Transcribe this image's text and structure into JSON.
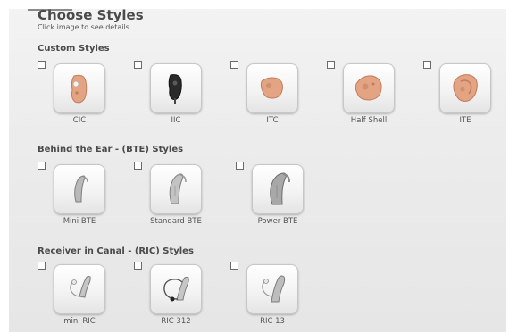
{
  "header": {
    "title": "Choose Styles",
    "subtitle": "Click image to see details"
  },
  "sections": [
    {
      "heading": "Custom Styles",
      "items": [
        {
          "label": "CIC",
          "icon": "cic-hearing-aid-icon"
        },
        {
          "label": "IIC",
          "icon": "iic-hearing-aid-icon"
        },
        {
          "label": "ITC",
          "icon": "itc-hearing-aid-icon"
        },
        {
          "label": "Half Shell",
          "icon": "half-shell-hearing-aid-icon"
        },
        {
          "label": "ITE",
          "icon": "ite-hearing-aid-icon"
        }
      ]
    },
    {
      "heading": "Behind the Ear - (BTE) Styles",
      "items": [
        {
          "label": "Mini BTE",
          "icon": "mini-bte-hearing-aid-icon"
        },
        {
          "label": "Standard BTE",
          "icon": "standard-bte-hearing-aid-icon"
        },
        {
          "label": "Power BTE",
          "icon": "power-bte-hearing-aid-icon"
        }
      ]
    },
    {
      "heading": "Receiver in Canal - (RIC) Styles",
      "items": [
        {
          "label": "mini RIC",
          "icon": "mini-ric-hearing-aid-icon"
        },
        {
          "label": "RIC 312",
          "icon": "ric-312-hearing-aid-icon"
        },
        {
          "label": "RIC 13",
          "icon": "ric-13-hearing-aid-icon"
        }
      ]
    }
  ],
  "colors": {
    "skin": "#e2a482",
    "skin_dark": "#c57b5a",
    "black_shell": "#2a2a2a",
    "silver": "#b9b9b9",
    "silver_dark": "#7d7d7d"
  }
}
